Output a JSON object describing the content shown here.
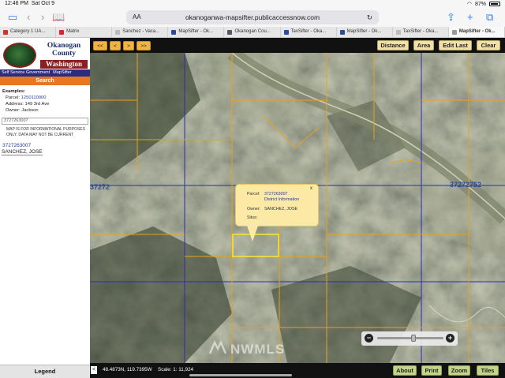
{
  "status": {
    "time": "12:46 PM",
    "date": "Sat Oct 9",
    "battery": "87%"
  },
  "browser": {
    "url": "okanoganwa-mapsifter.publicaccessnow.com",
    "aa": "AA",
    "tabs": [
      {
        "label": "Category 1 UA..."
      },
      {
        "label": "Matrix"
      },
      {
        "label": "Sanchez - Vaca..."
      },
      {
        "label": "MapSifter - Ok..."
      },
      {
        "label": "Okanogan Cou..."
      },
      {
        "label": "TaxSifter - Oka..."
      },
      {
        "label": "MapSifter - Ok..."
      },
      {
        "label": "TaxSifter - Oka..."
      },
      {
        "label": "MapSifter - Ok..."
      }
    ]
  },
  "sidebar": {
    "county": "Okanogan",
    "county2": "County",
    "state": "Washington",
    "links": [
      "Self Service Government",
      "MapSifter"
    ],
    "search_title": "Search",
    "examples_head": "Examples:",
    "ex_parcel_label": "Parcel:",
    "ex_parcel_value": "1250110000",
    "ex_address": "Address: 149 3rd Ave",
    "ex_owner": "Owner: Jackson",
    "search_value": "3727263007",
    "notice": "MAP IS FOR INFORMATIONAL PURPOSES ONLY. DATA MAY NOT BE CURRENT",
    "result_parcel": "3727263007",
    "result_owner": "SANCHEZ, JOSE",
    "legend": "Legend"
  },
  "toolbar": {
    "first": "<<",
    "prev": "<",
    "next": ">",
    "last": ">>",
    "distance": "Distance",
    "area": "Area",
    "edit_last": "Edit Last",
    "clear": "Clear"
  },
  "popup": {
    "close": "x",
    "parcel_label": "Parcel:",
    "parcel_value": "3727263007",
    "district_link": "District Information",
    "owner_label": "Owner:",
    "owner_value": "SANCHEZ, JOSE",
    "situs_label": "Situs:"
  },
  "map": {
    "label_left": "37272",
    "label_right": "37272752",
    "watermark": "NWMLS",
    "zoom_level": 0.55
  },
  "bottom": {
    "coords": "48.4873N, 119.7395W",
    "scale": "Scale: 1: 11,924",
    "about": "About",
    "print": "Print",
    "zoom": "Zoom",
    "tiles": "Tiles"
  },
  "colors": {
    "search_orange": "#e87722",
    "parcel_line": "#e8a11c",
    "section_line": "#2b2bb8"
  }
}
